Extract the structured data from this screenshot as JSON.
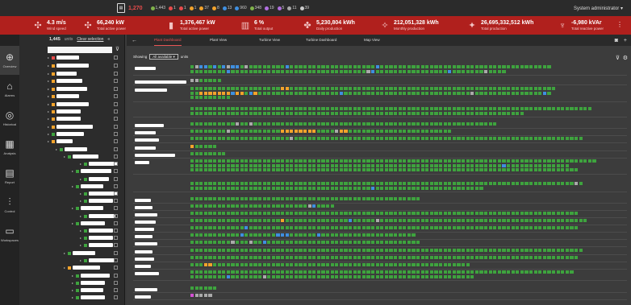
{
  "topbar": {
    "total_units": "1,270",
    "stats": [
      {
        "icon": "grid-icon",
        "value": "1,443",
        "color": "#7fb24a"
      },
      {
        "icon": "alert-icon",
        "value": "1",
        "color": "#e84b4b"
      },
      {
        "icon": "alert-icon",
        "value": "1",
        "color": "#e84b4b"
      },
      {
        "icon": "warning-icon",
        "value": "1",
        "color": "#f3a32b"
      },
      {
        "icon": "warning-icon",
        "value": "37",
        "color": "#f3a32b"
      },
      {
        "icon": "warning-icon",
        "value": "8",
        "color": "#f3a32b"
      },
      {
        "icon": "info-icon",
        "value": "13",
        "color": "#3f8fe0"
      },
      {
        "icon": "info-icon",
        "value": "960",
        "color": "#3f8fe0"
      },
      {
        "icon": "check-icon",
        "value": "348",
        "color": "#7fb24a"
      },
      {
        "icon": "arrow-icon",
        "value": "19",
        "color": "#b070e0"
      },
      {
        "icon": "arrow-icon",
        "value": "5",
        "color": "#b070e0"
      },
      {
        "icon": "arrow-icon",
        "value": "11",
        "color": "#aaaaaa"
      },
      {
        "icon": "clock-icon",
        "value": "39",
        "color": "#cccccc"
      }
    ],
    "user": "System administrator"
  },
  "kpis": [
    {
      "icon": "wind-icon",
      "value": "4.3 m/s",
      "label": "Wind speed"
    },
    {
      "icon": "power-icon",
      "value": "66,240 kW",
      "label": "Total active power"
    },
    {
      "icon": "battery-icon",
      "value": "1,376,467 kW",
      "label": "Total active power"
    },
    {
      "icon": "output-icon",
      "value": "6 %",
      "label": "Total output"
    },
    {
      "icon": "daily-icon",
      "value": "5,230,804 kWh",
      "label": "Daily production"
    },
    {
      "icon": "monthly-icon",
      "value": "212,051,328 kWh",
      "label": "Monthly production"
    },
    {
      "icon": "total-icon",
      "value": "26,695,332,512 kWh",
      "label": "Total production"
    },
    {
      "icon": "reactive-icon",
      "value": "-6,980 kVAr",
      "label": "Total reactive power"
    }
  ],
  "nav": [
    {
      "icon": "globe-icon",
      "label": "Overview"
    },
    {
      "icon": "bank-icon",
      "label": "Alarms"
    },
    {
      "icon": "history-icon",
      "label": "Historical"
    },
    {
      "icon": "analysis-icon",
      "label": "Analysis"
    },
    {
      "icon": "report-icon",
      "label": "Report"
    },
    {
      "icon": "control-icon",
      "label": "Control"
    },
    {
      "icon": "monitor-icon",
      "label": "Workspaces"
    }
  ],
  "tree": {
    "count": "1,445",
    "units_label": "units",
    "clear_label": "Clear selection"
  },
  "tabs": [
    "Plant Dashboard",
    "Plant View",
    "Turbine View",
    "Turbine Dashboard",
    "Map View"
  ],
  "filter": {
    "showing_label": "Showing",
    "selected": "All available",
    "units_label": "units"
  },
  "colors": {
    "ok": "#3ea33e",
    "warn": "#f3a32b",
    "info": "#3f8fe0",
    "idle": "#aaaaaa",
    "fault": "#e84b4b",
    "special": "#d44fd4"
  }
}
